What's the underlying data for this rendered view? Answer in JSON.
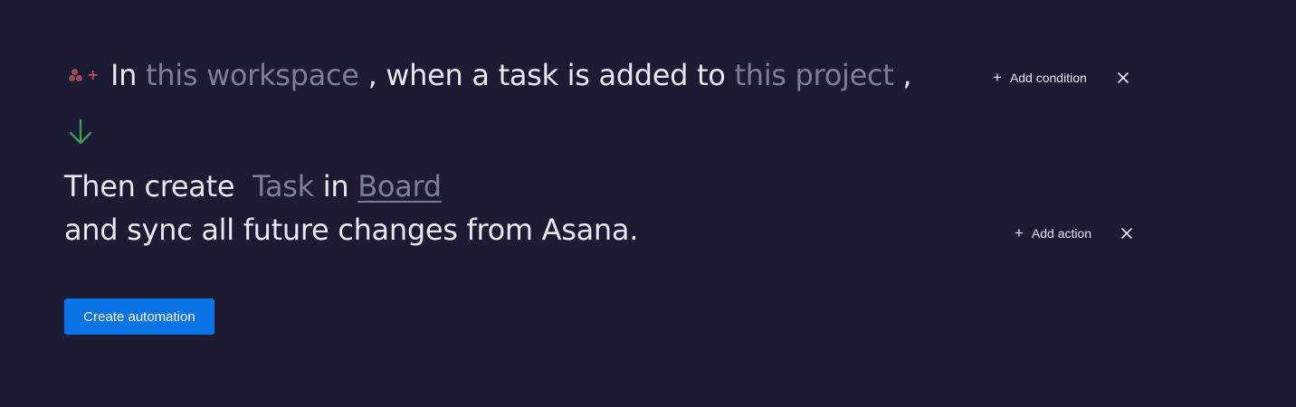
{
  "trigger": {
    "logo_icon": "asana-icon",
    "prefix": "In",
    "workspace_placeholder": "this workspace",
    "middle": ", when a task is added to",
    "project_placeholder": "this project",
    "suffix": ",",
    "add_condition_label": "Add condition",
    "accent_color": "#c2485e"
  },
  "connector": {
    "icon": "arrow-down-icon",
    "color": "#3f9a57"
  },
  "action": {
    "prefix": "Then create",
    "item_placeholder": "Task",
    "in_word": "in",
    "board_link": "Board",
    "line2": "and sync all future changes from Asana.",
    "add_action_label": "Add action"
  },
  "footer": {
    "create_button_label": "Create automation",
    "accent_color": "#0a73e5"
  }
}
